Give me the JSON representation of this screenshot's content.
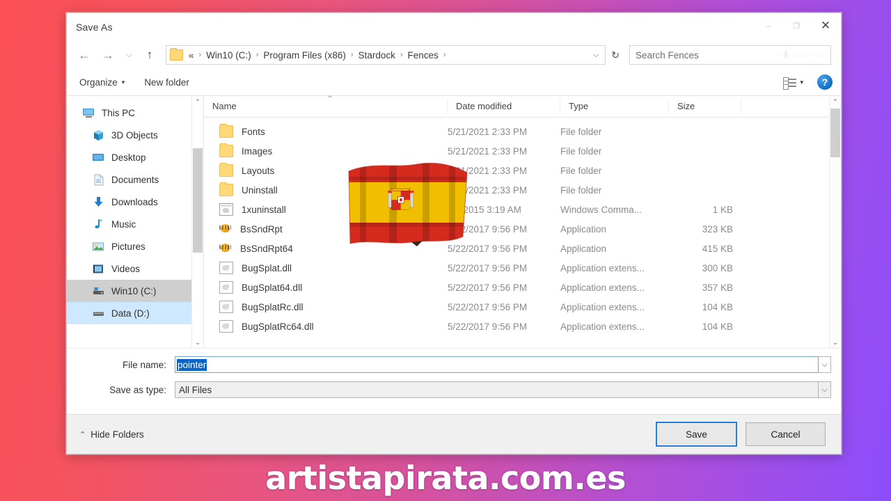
{
  "watermark": "artistapirata.com.es",
  "dialog": {
    "title": "Save As",
    "window_controls": {
      "minimize": "–",
      "maximize": "❐",
      "close": "✕"
    },
    "nav": {
      "back": "←",
      "forward": "→",
      "recent": "⌵",
      "up": "↑",
      "breadcrumbs": [
        "«",
        "Win10 (C:)",
        "Program Files (x86)",
        "Stardock",
        "Fences"
      ],
      "separator": "›",
      "dropdown_caret": "⌵",
      "refresh": "↻"
    },
    "search": {
      "placeholder": "Search Fences",
      "blurred_text": "· ·|· ····· ·· ··"
    },
    "toolbar": {
      "organize": "Organize",
      "organize_caret": "▾",
      "new_folder": "New folder",
      "view_caret": "▾",
      "help": "?"
    },
    "nav_pane": {
      "items": [
        {
          "label": "This PC",
          "icon": "monitor-icon",
          "indent": false,
          "state": "normal"
        },
        {
          "label": "3D Objects",
          "icon": "cube-icon",
          "indent": true,
          "state": "normal"
        },
        {
          "label": "Desktop",
          "icon": "desktop-icon",
          "indent": true,
          "state": "normal"
        },
        {
          "label": "Documents",
          "icon": "documents-icon",
          "indent": true,
          "state": "normal"
        },
        {
          "label": "Downloads",
          "icon": "download-icon",
          "indent": true,
          "state": "normal"
        },
        {
          "label": "Music",
          "icon": "music-icon",
          "indent": true,
          "state": "normal"
        },
        {
          "label": "Pictures",
          "icon": "pictures-icon",
          "indent": true,
          "state": "normal"
        },
        {
          "label": "Videos",
          "icon": "videos-icon",
          "indent": true,
          "state": "normal"
        },
        {
          "label": "Win10 (C:)",
          "icon": "drive-icon",
          "indent": true,
          "state": "selected"
        },
        {
          "label": "Data (D:)",
          "icon": "drive-icon",
          "indent": true,
          "state": "focused"
        }
      ],
      "scroll_up": "⌃",
      "scroll_down": "⌄"
    },
    "file_list": {
      "columns": [
        "Name",
        "Date modified",
        "Type",
        "Size"
      ],
      "sort_arrow": "⌃",
      "scroll_up": "⌃",
      "scroll_down": "⌄",
      "rows": [
        {
          "name": "Fonts",
          "icon": "folder-icon",
          "date": "5/21/2021 2:33 PM",
          "type": "File folder",
          "size": ""
        },
        {
          "name": "Images",
          "icon": "folder-icon",
          "date": "5/21/2021 2:33 PM",
          "type": "File folder",
          "size": ""
        },
        {
          "name": "Layouts",
          "icon": "folder-icon",
          "date": "5/21/2021 2:33 PM",
          "type": "File folder",
          "size": ""
        },
        {
          "name": "Uninstall",
          "icon": "folder-icon",
          "date": "5/21/2021 2:33 PM",
          "type": "File folder",
          "size": ""
        },
        {
          "name": "1xuninstall",
          "icon": "cmd-icon",
          "date": "9/1/2015 3:19 AM",
          "type": "Windows Comma...",
          "size": "1 KB"
        },
        {
          "name": "BsSndRpt",
          "icon": "app-icon",
          "date": "5/22/2017 9:56 PM",
          "type": "Application",
          "size": "323 KB"
        },
        {
          "name": "BsSndRpt64",
          "icon": "app-icon",
          "date": "5/22/2017 9:56 PM",
          "type": "Application",
          "size": "415 KB"
        },
        {
          "name": "BugSplat.dll",
          "icon": "dll-icon",
          "date": "5/22/2017 9:56 PM",
          "type": "Application extens...",
          "size": "300 KB"
        },
        {
          "name": "BugSplat64.dll",
          "icon": "dll-icon",
          "date": "5/22/2017 9:56 PM",
          "type": "Application extens...",
          "size": "357 KB"
        },
        {
          "name": "BugSplatRc.dll",
          "icon": "dll-icon",
          "date": "5/22/2017 9:56 PM",
          "type": "Application extens...",
          "size": "104 KB"
        },
        {
          "name": "BugSplatRc64.dll",
          "icon": "dll-icon",
          "date": "5/22/2017 9:56 PM",
          "type": "Application extens...",
          "size": "104 KB"
        }
      ]
    },
    "form": {
      "file_name_label": "File name:",
      "file_name_value": "pointer",
      "file_name_caret": "⌵",
      "save_as_type_label": "Save as type:",
      "save_as_type_value": "All Files",
      "save_as_type_caret": "⌵"
    },
    "footer": {
      "hide_folders": "Hide Folders",
      "hide_folders_chevron": "⌃",
      "save": "Save",
      "cancel": "Cancel"
    }
  },
  "overlay": {
    "flag": "spain-flag"
  },
  "colors": {
    "bg_left": "#fc4f55",
    "bg_right": "#8c4dfc",
    "selection_blue": "#0a64c8",
    "focus_blue": "#cde8ff",
    "accent_button_border": "#2a7fd4",
    "flag_red": "#d52b1e",
    "flag_yellow": "#f1bf00"
  }
}
